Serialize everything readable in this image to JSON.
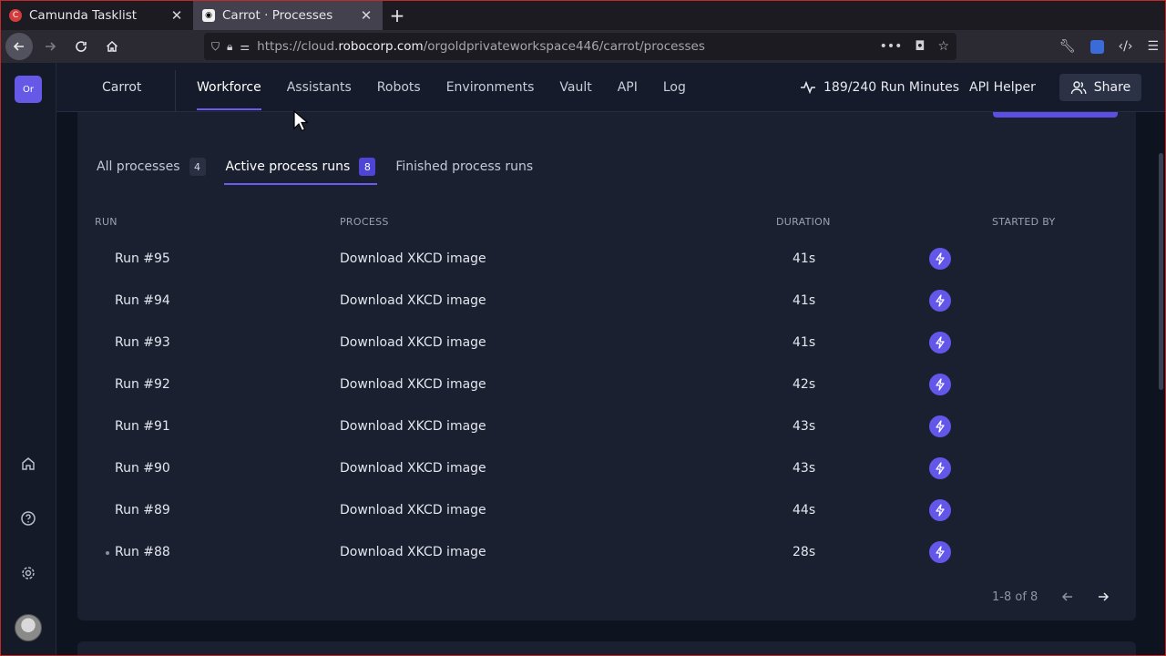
{
  "browser": {
    "tabs": [
      {
        "title": "Camunda Tasklist",
        "active": false
      },
      {
        "title": "Carrot · Processes",
        "active": true
      }
    ],
    "url_prefix": "https://cloud.",
    "url_host": "robocorp.com",
    "url_path": "/orgoldprivateworkspace446/carrot/processes"
  },
  "sidebar": {
    "org_badge": "Or",
    "icons": [
      "home-icon",
      "help-icon",
      "settings-icon"
    ]
  },
  "header": {
    "workspace": "Carrot",
    "nav": [
      {
        "label": "Workforce",
        "active": true
      },
      {
        "label": "Assistants",
        "active": false
      },
      {
        "label": "Robots",
        "active": false
      },
      {
        "label": "Environments",
        "active": false
      },
      {
        "label": "Vault",
        "active": false
      },
      {
        "label": "API",
        "active": false
      },
      {
        "label": "Log",
        "active": false
      }
    ],
    "run_minutes": "189/240 Run Minutes",
    "api_helper": "API Helper",
    "share": "Share"
  },
  "subtabs": [
    {
      "label": "All processes",
      "count": "4",
      "active": false
    },
    {
      "label": "Active process runs",
      "count": "8",
      "active": true
    },
    {
      "label": "Finished process runs",
      "count": "",
      "active": false
    }
  ],
  "table": {
    "columns": {
      "run": "RUN",
      "process": "PROCESS",
      "duration": "DURATION",
      "started_by": "STARTED BY"
    },
    "rows": [
      {
        "run": "Run #95",
        "process": "Download XKCD image",
        "duration": "41s"
      },
      {
        "run": "Run #94",
        "process": "Download XKCD image",
        "duration": "41s"
      },
      {
        "run": "Run #93",
        "process": "Download XKCD image",
        "duration": "41s"
      },
      {
        "run": "Run #92",
        "process": "Download XKCD image",
        "duration": "42s"
      },
      {
        "run": "Run #91",
        "process": "Download XKCD image",
        "duration": "43s"
      },
      {
        "run": "Run #90",
        "process": "Download XKCD image",
        "duration": "43s"
      },
      {
        "run": "Run #89",
        "process": "Download XKCD image",
        "duration": "44s"
      },
      {
        "run": "Run #88",
        "process": "Download XKCD image",
        "duration": "28s"
      }
    ]
  },
  "pagination": {
    "range": "1-8 of 8"
  },
  "colors": {
    "accent": "#6357ea",
    "background": "#0e1320",
    "card": "#1a2030"
  }
}
